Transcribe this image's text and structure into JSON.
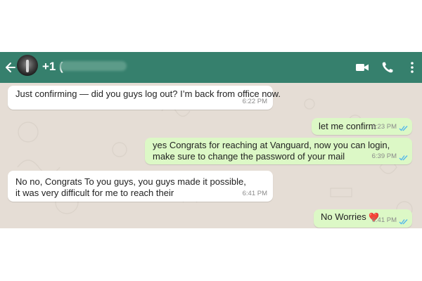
{
  "header": {
    "contact_prefix": "+1 (",
    "back_icon": "arrow-left-icon",
    "actions": [
      "video-call-icon",
      "phone-icon",
      "more-vertical-icon"
    ],
    "bar_color": "#36806d"
  },
  "messages": [
    {
      "direction": "incoming",
      "text": "Just confirming — did you guys log out? I’m back from office now.",
      "time": "6:22 PM"
    },
    {
      "direction": "outgoing",
      "text": "let me confirm",
      "time": "6:23 PM",
      "status": "read"
    },
    {
      "direction": "outgoing",
      "text": "yes Congrats for reaching at Vanguard, now you can login, make sure to change the password of your mail",
      "time": "6:39 PM",
      "status": "read"
    },
    {
      "direction": "incoming",
      "text": "No no, Congrats To you guys, you guys made it possible, it was very difficult for me to reach their",
      "time": "6:41 PM"
    },
    {
      "direction": "outgoing",
      "text": "No Worries",
      "emoji": "❤️",
      "time": "6:41 PM",
      "status": "read"
    }
  ],
  "colors": {
    "incoming_bubble": "#ffffff",
    "outgoing_bubble": "#dcf8c6",
    "chat_background": "#e5ddd5",
    "read_tick": "#4fb6ec"
  }
}
